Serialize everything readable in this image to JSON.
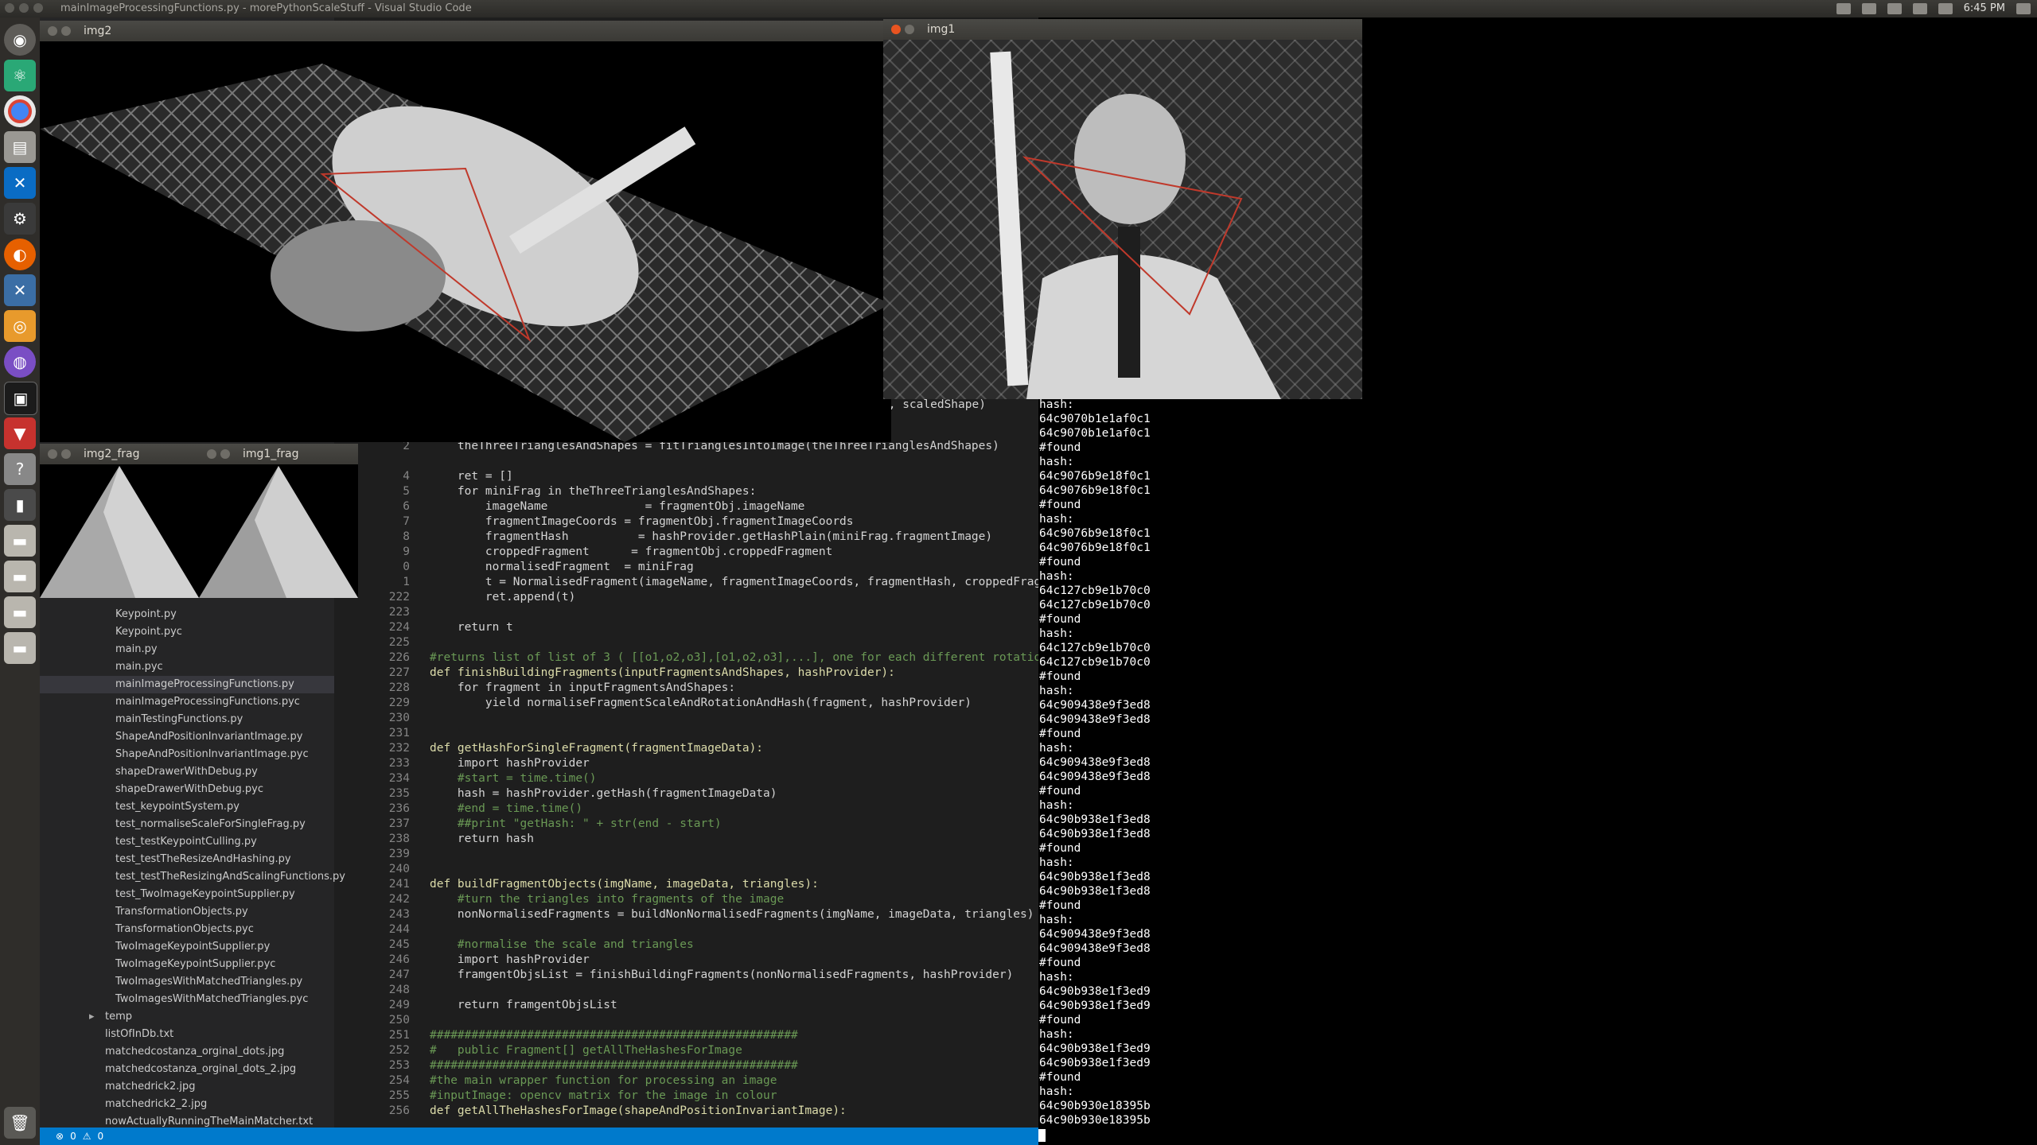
{
  "top_panel": {
    "title": "mainImageProcessingFunctions.py - morePythonScaleStuff - Visual Studio Code",
    "clock": "6:45 PM"
  },
  "windows": {
    "img2": "img2",
    "img1": "img1",
    "img2_frag": "img2_frag",
    "img1_frag": "img1_frag"
  },
  "status_bar": {
    "errors": "0",
    "warnings": "0"
  },
  "sidebar": {
    "files": [
      {
        "name": "Keypoint.py"
      },
      {
        "name": "Keypoint.pyc"
      },
      {
        "name": "main.py"
      },
      {
        "name": "main.pyc"
      },
      {
        "name": "mainImageProcessingFunctions.py"
      },
      {
        "name": "mainImageProcessingFunctions.pyc"
      },
      {
        "name": "mainTestingFunctions.py"
      },
      {
        "name": "ShapeAndPositionInvariantImage.py"
      },
      {
        "name": "ShapeAndPositionInvariantImage.pyc"
      },
      {
        "name": "shapeDrawerWithDebug.py"
      },
      {
        "name": "shapeDrawerWithDebug.pyc"
      },
      {
        "name": "test_keypointSystem.py"
      },
      {
        "name": "test_normaliseScaleForSingleFrag.py"
      },
      {
        "name": "test_testKeypointCulling.py"
      },
      {
        "name": "test_testTheResizeAndHashing.py"
      },
      {
        "name": "test_testTheResizingAndScalingFunctions.py"
      },
      {
        "name": "test_TwoImageKeypointSupplier.py"
      },
      {
        "name": "TransformationObjects.py"
      },
      {
        "name": "TransformationObjects.pyc"
      },
      {
        "name": "TwoImageKeypointSupplier.py"
      },
      {
        "name": "TwoImageKeypointSupplier.pyc"
      },
      {
        "name": "TwoImagesWithMatchedTriangles.py"
      },
      {
        "name": "TwoImagesWithMatchedTriangles.pyc"
      },
      {
        "name": "temp"
      },
      {
        "name": "listOfInDb.txt"
      },
      {
        "name": "matchedcostanza_orginal_dots.jpg"
      },
      {
        "name": "matchedcostanza_orginal_dots_2.jpg"
      },
      {
        "name": "matchedrick2.jpg"
      },
      {
        "name": "matchedrick2_2.jpg"
      },
      {
        "name": "nowActuallyRunningTheMainMatcher.txt"
      }
    ]
  },
  "code_partial": "e, scaledShape)",
  "code": [
    {
      "n": "2",
      "t": "    theThreeTrianglesAndShapes = fitTrianglesIntoImage(theThreeTrianglesAndShapes)"
    },
    {
      "n": "",
      "t": ""
    },
    {
      "n": "4",
      "t": "    ret = []"
    },
    {
      "n": "5",
      "t": "    for miniFrag in theThreeTrianglesAndShapes:"
    },
    {
      "n": "6",
      "t": "        imageName              = fragmentObj.imageName"
    },
    {
      "n": "7",
      "t": "        fragmentImageCoords = fragmentObj.fragmentImageCoords"
    },
    {
      "n": "8",
      "t": "        fragmentHash          = hashProvider.getHashPlain(miniFrag.fragmentImage)"
    },
    {
      "n": "9",
      "t": "        croppedFragment      = fragmentObj.croppedFragment"
    },
    {
      "n": "0",
      "t": "        normalisedFragment  = miniFrag"
    },
    {
      "n": "1",
      "t": "        t = NormalisedFragment(imageName, fragmentImageCoords, fragmentHash, croppedFragment, nor"
    },
    {
      "n": "222",
      "t": "        ret.append(t)"
    },
    {
      "n": "223",
      "t": ""
    },
    {
      "n": "224",
      "t": "    return t"
    },
    {
      "n": "225",
      "t": ""
    },
    {
      "n": "226",
      "t": "#returns list of list of 3 ( [[o1,o2,o3],[o1,o2,o3],...], one for each different rotation)"
    },
    {
      "n": "227",
      "t": "def finishBuildingFragments(inputFragmentsAndShapes, hashProvider):"
    },
    {
      "n": "228",
      "t": "    for fragment in inputFragmentsAndShapes:"
    },
    {
      "n": "229",
      "t": "        yield normaliseFragmentScaleAndRotationAndHash(fragment, hashProvider)"
    },
    {
      "n": "230",
      "t": ""
    },
    {
      "n": "231",
      "t": ""
    },
    {
      "n": "232",
      "t": "def getHashForSingleFragment(fragmentImageData):"
    },
    {
      "n": "233",
      "t": "    import hashProvider"
    },
    {
      "n": "234",
      "t": "    #start = time.time()"
    },
    {
      "n": "235",
      "t": "    hash = hashProvider.getHash(fragmentImageData)"
    },
    {
      "n": "236",
      "t": "    #end = time.time()"
    },
    {
      "n": "237",
      "t": "    ##print \"getHash: \" + str(end - start)"
    },
    {
      "n": "238",
      "t": "    return hash"
    },
    {
      "n": "239",
      "t": ""
    },
    {
      "n": "240",
      "t": ""
    },
    {
      "n": "241",
      "t": "def buildFragmentObjects(imgName, imageData, triangles):"
    },
    {
      "n": "242",
      "t": "    #turn the triangles into fragments of the image"
    },
    {
      "n": "243",
      "t": "    nonNormalisedFragments = buildNonNormalisedFragments(imgName, imageData, triangles)"
    },
    {
      "n": "244",
      "t": ""
    },
    {
      "n": "245",
      "t": "    #normalise the scale and triangles"
    },
    {
      "n": "246",
      "t": "    import hashProvider"
    },
    {
      "n": "247",
      "t": "    framgentObjsList = finishBuildingFragments(nonNormalisedFragments, hashProvider)"
    },
    {
      "n": "248",
      "t": ""
    },
    {
      "n": "249",
      "t": "    return framgentObjsList"
    },
    {
      "n": "250",
      "t": ""
    },
    {
      "n": "251",
      "t": "#####################################################"
    },
    {
      "n": "252",
      "t": "#   public Fragment[] getAllTheHashesForImage"
    },
    {
      "n": "253",
      "t": "#####################################################"
    },
    {
      "n": "254",
      "t": "#the main wrapper function for processing an image"
    },
    {
      "n": "255",
      "t": "#inputImage: opencv matrix for the image in colour"
    },
    {
      "n": "256",
      "t": "def getAllTheHashesForImage(shapeAndPositionInvariantImage):"
    }
  ],
  "terminal": [
    "hash:",
    "64c9070b1e1af0c1",
    "64c9070b1e1af0c1",
    "#found",
    "hash:",
    "64c9076b9e18f0c1",
    "64c9076b9e18f0c1",
    "#found",
    "hash:",
    "64c9076b9e18f0c1",
    "64c9076b9e18f0c1",
    "#found",
    "hash:",
    "64c127cb9e1b70c0",
    "64c127cb9e1b70c0",
    "#found",
    "hash:",
    "64c127cb9e1b70c0",
    "64c127cb9e1b70c0",
    "#found",
    "hash:",
    "64c909438e9f3ed8",
    "64c909438e9f3ed8",
    "#found",
    "hash:",
    "64c909438e9f3ed8",
    "64c909438e9f3ed8",
    "#found",
    "hash:",
    "64c90b938e1f3ed8",
    "64c90b938e1f3ed8",
    "#found",
    "hash:",
    "64c90b938e1f3ed8",
    "64c90b938e1f3ed8",
    "#found",
    "hash:",
    "64c909438e9f3ed8",
    "64c909438e9f3ed8",
    "#found",
    "hash:",
    "64c90b938e1f3ed9",
    "64c90b938e1f3ed9",
    "#found",
    "hash:",
    "64c90b938e1f3ed9",
    "64c90b938e1f3ed9",
    "#found",
    "hash:",
    "64c90b930e18395b",
    "64c90b930e18395b"
  ]
}
